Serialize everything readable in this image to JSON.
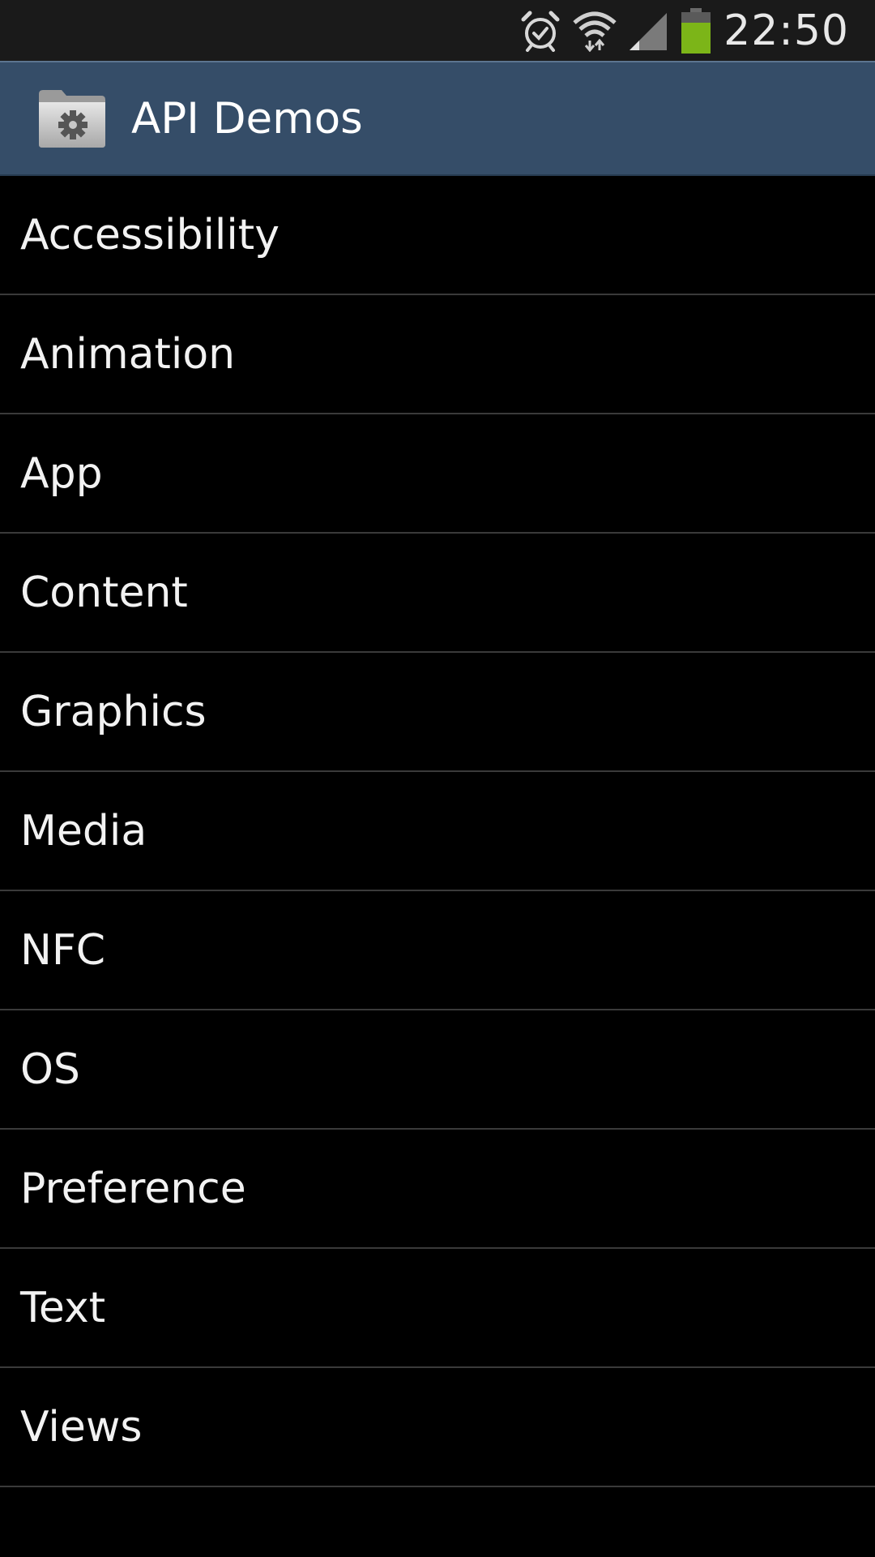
{
  "status_bar": {
    "time": "22:50",
    "icons": [
      "alarm-icon",
      "wifi-icon",
      "signal-icon",
      "battery-icon"
    ],
    "battery_color": "#7cb518"
  },
  "action_bar": {
    "title": "API Demos",
    "icon": "settings-folder-icon",
    "background": "#354d68"
  },
  "list": {
    "items": [
      {
        "label": "Accessibility"
      },
      {
        "label": "Animation"
      },
      {
        "label": "App"
      },
      {
        "label": "Content"
      },
      {
        "label": "Graphics"
      },
      {
        "label": "Media"
      },
      {
        "label": "NFC"
      },
      {
        "label": "OS"
      },
      {
        "label": "Preference"
      },
      {
        "label": "Text"
      },
      {
        "label": "Views"
      }
    ]
  }
}
